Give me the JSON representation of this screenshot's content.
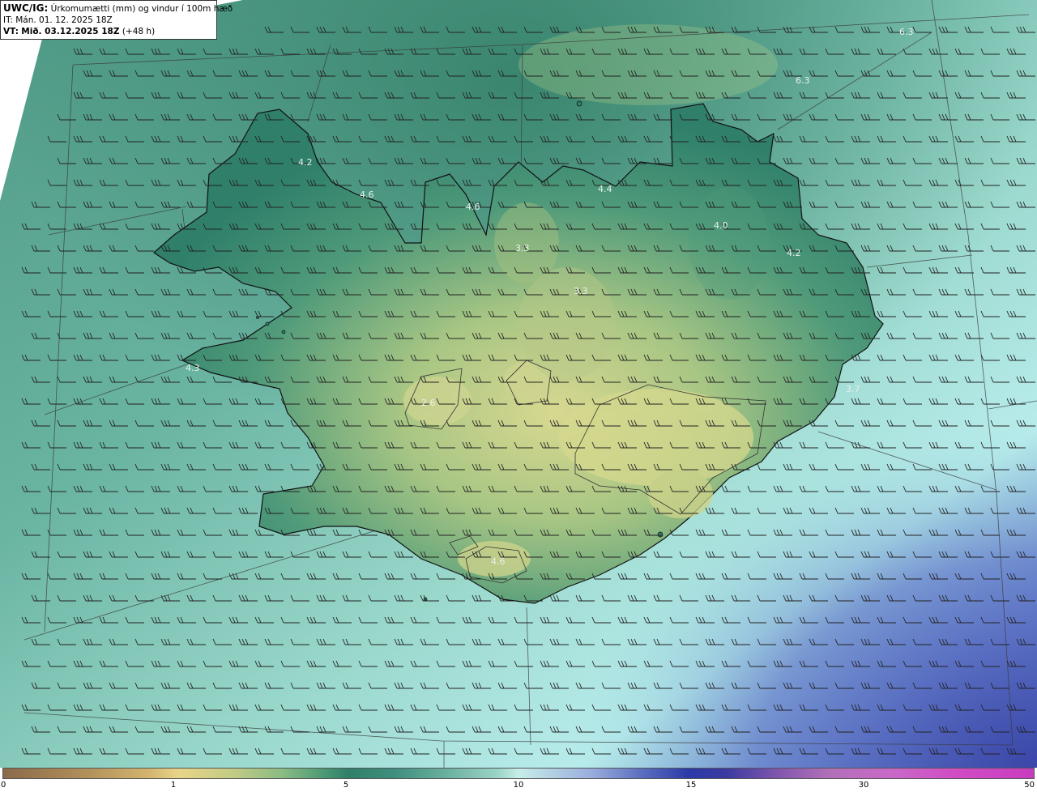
{
  "header": {
    "line1_key": "UWC/IG:",
    "line1_val": "Úrkomumætti (mm) og vindur í 100m hæð",
    "line2": "IT: Mán. 01. 12. 2025 18Z",
    "line3_key": "VT:",
    "line3_val": "Mið. 03.12.2025 18Z",
    "line3_suffix": "(+48 h)"
  },
  "colorbar": {
    "ticks": [
      "0",
      "1",
      "5",
      "10",
      "15",
      "30",
      "50"
    ]
  },
  "labels": [
    "6.3",
    "6.3",
    "4.2",
    "4.6",
    "4.6",
    "4.4",
    "4.0",
    "4.2",
    "3.3",
    "3.3",
    "4.3",
    "3.7",
    "2.6",
    "4.6"
  ],
  "colors": {
    "land_low": "#2f7f6a",
    "land_high": "#d8d890",
    "sea": "#8fd0c4",
    "deep": "#4a5ab8"
  }
}
